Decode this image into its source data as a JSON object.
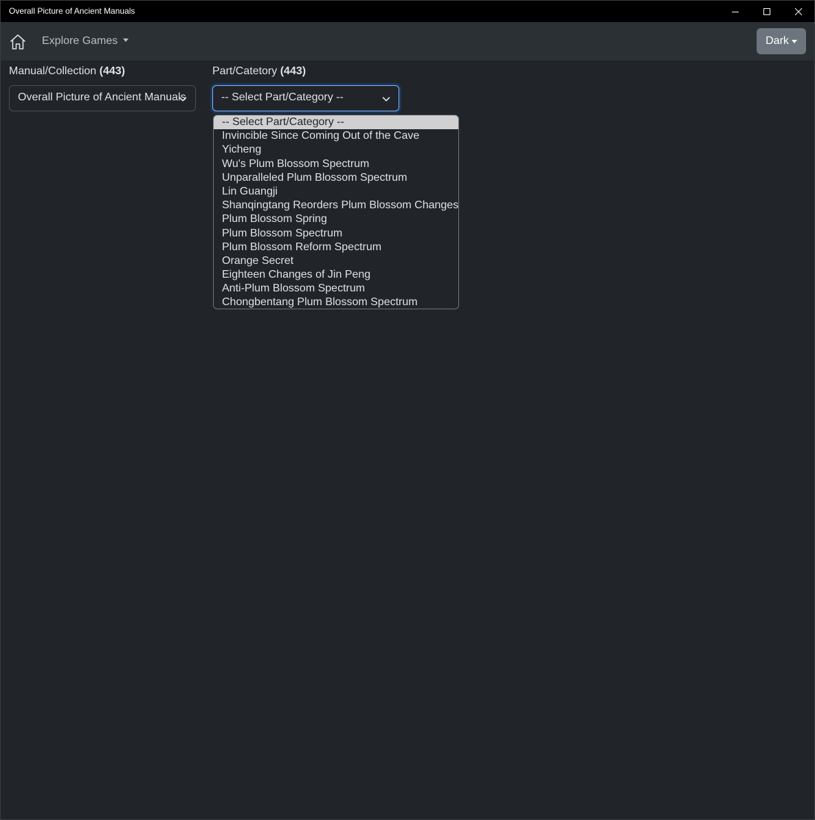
{
  "window": {
    "title": "Overall Picture of Ancient Manuals"
  },
  "navbar": {
    "explore_label": "Explore Games",
    "theme_label": "Dark"
  },
  "filters": {
    "manual": {
      "label": "Manual/Collection",
      "count": "(443)",
      "value": "Overall Picture of Ancient Manuals"
    },
    "part": {
      "label": "Part/Catetory",
      "count": "(443)",
      "value": "-- Select Part/Category --",
      "options": [
        "-- Select Part/Category --",
        "Invincible Since Coming Out of the Cave",
        "Yicheng",
        "Wu's Plum Blossom Spectrum",
        "Unparalleled Plum Blossom Spectrum",
        "Lin Guangji",
        "Shanqingtang Reorders Plum Blossom Changes",
        "Plum Blossom Spring",
        "Plum Blossom Spectrum",
        "Plum Blossom Reform Spectrum",
        "Orange Secret",
        "Eighteen Changes of Jin Peng",
        "Anti-Plum Blossom Spectrum",
        "Chongbentang Plum Blossom Spectrum"
      ]
    }
  },
  "icons": {
    "home": "home-icon",
    "dropdown": "chevron-down-icon",
    "minimize": "minimize-icon",
    "maximize": "maximize-icon",
    "close": "close-icon"
  },
  "colors": {
    "background": "#212529",
    "navbar": "#2b3035",
    "button": "#6c757d",
    "focus": "#86b7fe"
  }
}
